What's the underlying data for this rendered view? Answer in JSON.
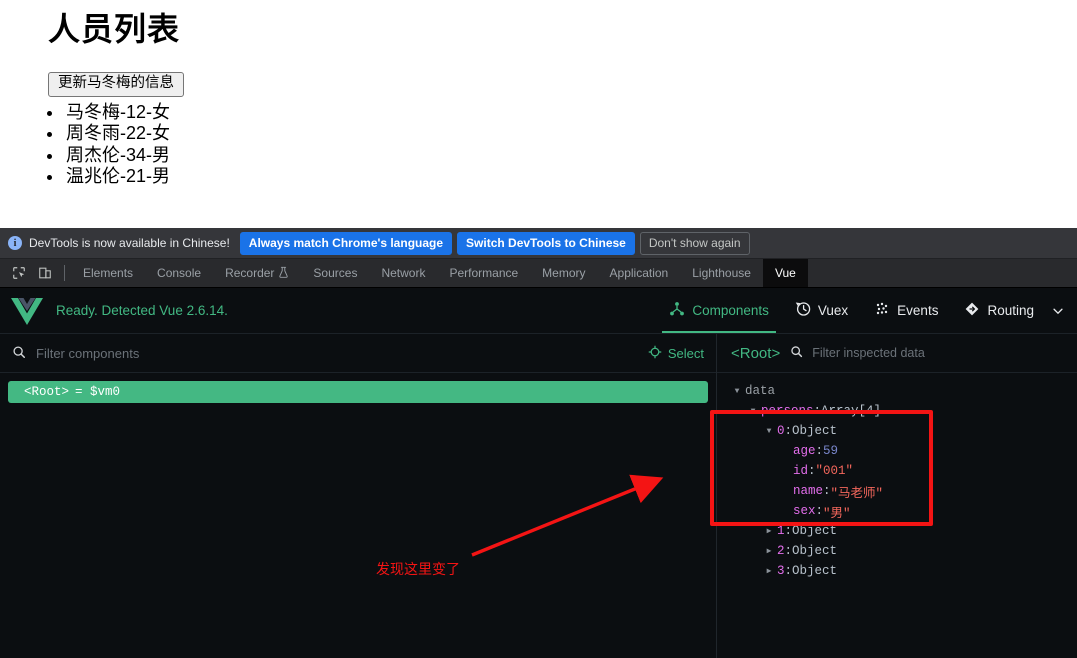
{
  "page": {
    "title": "人员列表",
    "update_button": "更新马冬梅的信息",
    "persons": [
      "马冬梅-12-女",
      "周冬雨-22-女",
      "周杰伦-34-男",
      "温兆伦-21-男"
    ]
  },
  "devtools": {
    "banner": {
      "icon": "info-icon",
      "message": "DevTools is now available in Chinese!",
      "btn_always": "Always match Chrome's language",
      "btn_switch": "Switch DevTools to Chinese",
      "btn_dismiss": "Don't show again"
    },
    "toolbar_icons": [
      {
        "name": "inspect-element-icon"
      },
      {
        "name": "device-toolbar-icon"
      }
    ],
    "tabs": [
      {
        "label": "Elements",
        "active": false
      },
      {
        "label": "Console",
        "active": false
      },
      {
        "label": "Recorder",
        "active": false,
        "icon": "flask-icon"
      },
      {
        "label": "Sources",
        "active": false
      },
      {
        "label": "Network",
        "active": false
      },
      {
        "label": "Performance",
        "active": false
      },
      {
        "label": "Memory",
        "active": false
      },
      {
        "label": "Application",
        "active": false
      },
      {
        "label": "Lighthouse",
        "active": false
      },
      {
        "label": "Vue",
        "active": true
      }
    ],
    "more_tabs_icon": "chevron-down-icon"
  },
  "vue": {
    "logo": "vue-logo",
    "status": "Ready. Detected Vue 2.6.14.",
    "nav": [
      {
        "label": "Components",
        "icon": "components-icon",
        "active": true
      },
      {
        "label": "Vuex",
        "icon": "history-clock-icon",
        "active": false
      },
      {
        "label": "Events",
        "icon": "events-dots-icon",
        "active": false
      },
      {
        "label": "Routing",
        "icon": "routing-diamond-icon",
        "active": false
      }
    ],
    "nav_overflow_icon": "chevron-down-icon",
    "components_panel": {
      "filter_placeholder": "Filter components",
      "search_icon": "search-icon",
      "select_label": "Select",
      "select_icon": "target-crosshair-icon",
      "tree": [
        {
          "label": "<Root>",
          "instance": "= $vm0",
          "selected": true
        }
      ]
    },
    "inspector": {
      "root_label": "<Root>",
      "search_icon": "search-icon",
      "filter_placeholder": "Filter inspected data",
      "rows": [
        {
          "indent": 0,
          "arrow": "down",
          "field": "data",
          "sep": "",
          "value": "",
          "vtype": "none"
        },
        {
          "indent": 1,
          "arrow": "down",
          "field": "persons",
          "sep": ": ",
          "value": "Array[4]",
          "vtype": "type",
          "keycolor": "key"
        },
        {
          "indent": 2,
          "arrow": "down",
          "field": "0",
          "sep": ": ",
          "value": "Object",
          "vtype": "type",
          "keycolor": "idx"
        },
        {
          "indent": 3,
          "arrow": "none",
          "field": "age",
          "sep": ": ",
          "value": "59",
          "vtype": "num",
          "keycolor": "key"
        },
        {
          "indent": 3,
          "arrow": "none",
          "field": "id",
          "sep": ": ",
          "value": "\"001\"",
          "vtype": "str",
          "keycolor": "key"
        },
        {
          "indent": 3,
          "arrow": "none",
          "field": "name",
          "sep": ": ",
          "value": "\"马老师\"",
          "vtype": "str",
          "keycolor": "key"
        },
        {
          "indent": 3,
          "arrow": "none",
          "field": "sex",
          "sep": ": ",
          "value": "\"男\"",
          "vtype": "str",
          "keycolor": "key"
        },
        {
          "indent": 2,
          "arrow": "right",
          "field": "1",
          "sep": ": ",
          "value": "Object",
          "vtype": "type",
          "keycolor": "idx"
        },
        {
          "indent": 2,
          "arrow": "right",
          "field": "2",
          "sep": ": ",
          "value": "Object",
          "vtype": "type",
          "keycolor": "idx"
        },
        {
          "indent": 2,
          "arrow": "right",
          "field": "3",
          "sep": ": ",
          "value": "Object",
          "vtype": "type",
          "keycolor": "idx"
        }
      ]
    }
  },
  "annotations": {
    "highlight_color": "#f41414",
    "caption": "发现这里变了"
  }
}
